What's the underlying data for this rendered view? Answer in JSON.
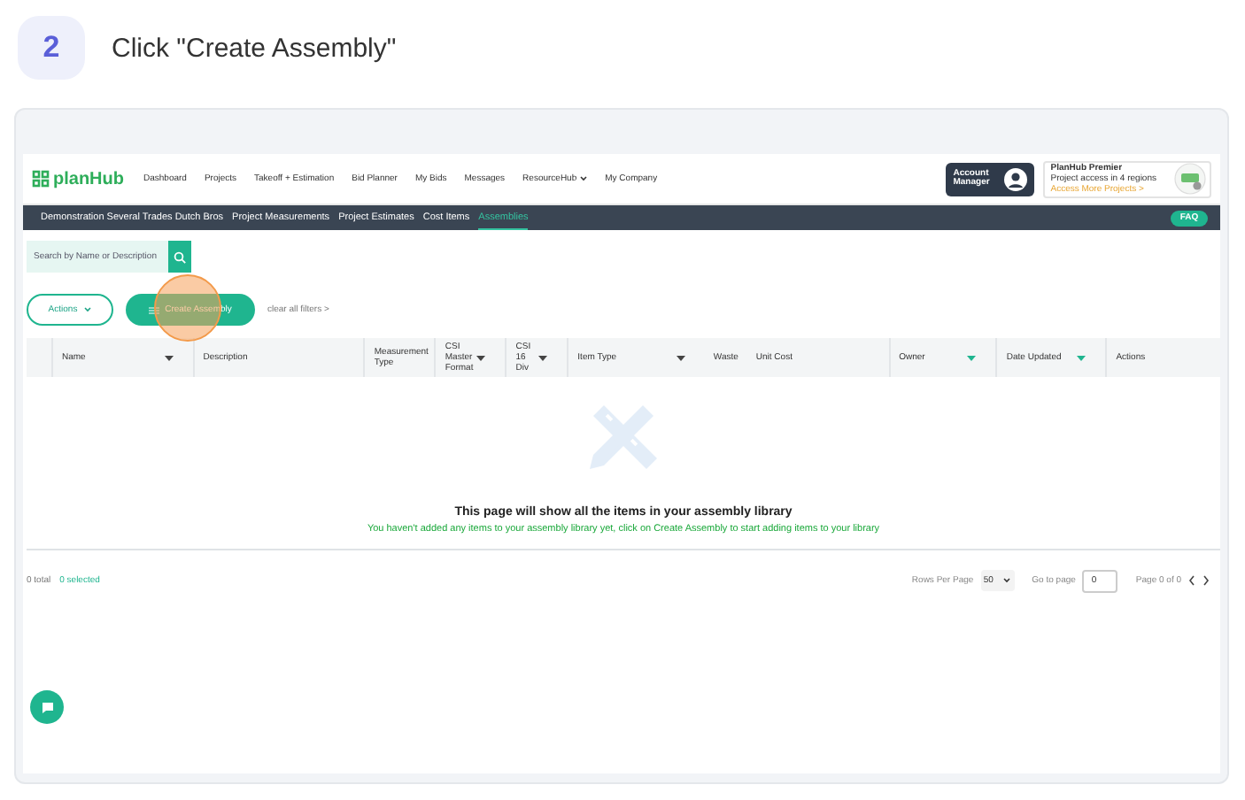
{
  "step": {
    "number": "2",
    "instruction": "Click \"Create Assembly\""
  },
  "header": {
    "logo": "planHub",
    "nav": [
      {
        "label": "Dashboard",
        "dropdown": false
      },
      {
        "label": "Projects",
        "dropdown": false
      },
      {
        "label": "Takeoff + Estimation",
        "dropdown": false
      },
      {
        "label": "Bid Planner",
        "dropdown": false
      },
      {
        "label": "My Bids",
        "dropdown": false
      },
      {
        "label": "Messages",
        "dropdown": false
      },
      {
        "label": "ResourceHub",
        "dropdown": true
      },
      {
        "label": "My Company",
        "dropdown": false
      }
    ],
    "account": "Account Manager",
    "premier": {
      "title": "PlanHub Premier",
      "subtitle": "Project access in 4 regions",
      "link": "Access More Projects >"
    }
  },
  "subnav": {
    "tabs": [
      {
        "label": "Demonstration Several Trades Dutch Bros",
        "selected": false
      },
      {
        "label": "Project Measurements",
        "selected": false
      },
      {
        "label": "Project Estimates",
        "selected": false
      },
      {
        "label": "Cost Items",
        "selected": false
      },
      {
        "label": "Assemblies",
        "selected": true
      }
    ],
    "faq": "FAQ"
  },
  "toolbar": {
    "search_placeholder": "Search by Name or Description",
    "actions": "Actions",
    "create": "Create Assembly",
    "clear": "clear all filters >"
  },
  "table": {
    "columns": [
      {
        "label": "Name",
        "kind": "filter"
      },
      {
        "label": "Description",
        "kind": "plain"
      },
      {
        "label": "Measurement Type",
        "kind": "plain"
      },
      {
        "label": "CSI Master Format",
        "kind": "filter"
      },
      {
        "label": "CSI 16 Div",
        "kind": "filter"
      },
      {
        "label": "Item Type",
        "kind": "filter"
      },
      {
        "label": "Waste",
        "kind": "plain"
      },
      {
        "label": "Unit Cost",
        "kind": "plain"
      },
      {
        "label": "Owner",
        "kind": "filtered"
      },
      {
        "label": "Date Updated",
        "kind": "filtered"
      },
      {
        "label": "Actions",
        "kind": "plain"
      }
    ],
    "empty_title": "This page will show all the items in your assembly library",
    "empty_message": "You haven't added any items to your assembly library yet, click on Create Assembly to start adding items to your library"
  },
  "footer": {
    "total": "0 total",
    "selected": "0 selected",
    "rows_label": "Rows Per Page",
    "rows_value": "50",
    "goto_label": "Go to page",
    "goto_value": "0",
    "page": "Page 0 of 0"
  }
}
